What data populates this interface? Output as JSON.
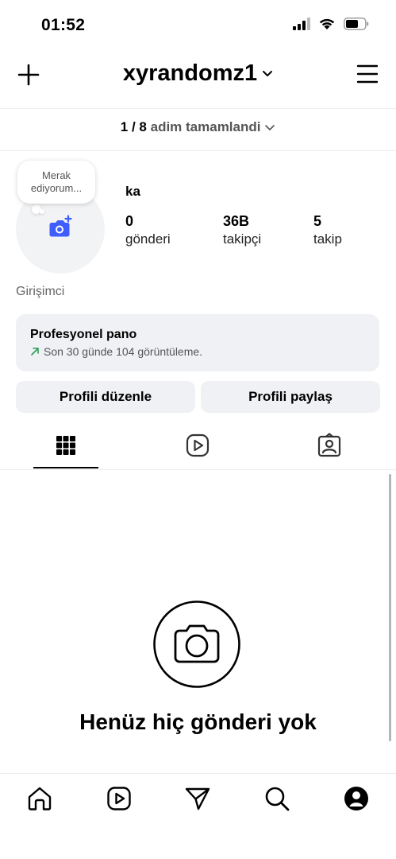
{
  "status_bar": {
    "time": "01:52"
  },
  "header": {
    "username": "xyrandomz1"
  },
  "progress": {
    "done": "1 / 8",
    "text": "adim tamamlandi"
  },
  "profile": {
    "bubble_line1": "Merak",
    "bubble_line2": "ediyorum...",
    "name": "ka",
    "stats": [
      {
        "value": "0",
        "label": "gönderi"
      },
      {
        "value": "36B",
        "label": "takipçi"
      },
      {
        "value": "5",
        "label": "takip"
      }
    ],
    "bio": "Girişimci"
  },
  "pro_panel": {
    "title": "Profesyonel pano",
    "subtitle": "Son 30 günde 104 görüntüleme."
  },
  "buttons": {
    "edit": "Profili düzenle",
    "share": "Profili paylaş"
  },
  "tabs": [
    "grid-icon",
    "reels-icon",
    "tagged-icon"
  ],
  "empty_state": {
    "text": "Henüz hiç gönderi yok"
  },
  "bottom_nav": [
    "home-icon",
    "reels-icon",
    "send-icon",
    "search-icon",
    "profile-icon"
  ],
  "colors": {
    "accent": "#3f5efb",
    "panel": "#eff1f4",
    "trend": "#2a9d58"
  }
}
